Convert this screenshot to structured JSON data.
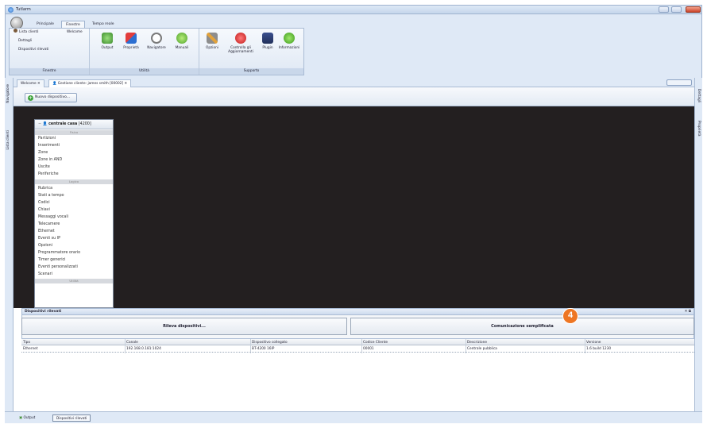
{
  "window": {
    "title": "Tutlarm"
  },
  "ribbon": {
    "tabs": [
      "Principale",
      "Finestre",
      "Tempo reale"
    ],
    "active_tab": "Finestre",
    "finestre_group": {
      "label": "Finestre",
      "items": [
        "Lista clienti",
        "Dettagli",
        "Dispositivi rilevati"
      ],
      "welcome": "Welcome"
    },
    "utilita_group": {
      "label": "Utilità",
      "buttons": [
        "Output",
        "Proprietà",
        "Navigatore",
        "Manuali"
      ]
    },
    "supporto_group": {
      "label": "Supporto",
      "buttons": [
        "Opzioni",
        "Controlla gli Aggiornamenti",
        "Plugin",
        "Informazioni"
      ]
    }
  },
  "side_panels": {
    "left": [
      "Navigatore",
      "Lista clienti"
    ],
    "right": [
      "Dettagli",
      "Proprietà"
    ]
  },
  "doc_tabs": [
    "Welcome",
    "Gestione cliente: james smith [00002]"
  ],
  "toolbar": {
    "new_device_label": "Nuovo dispositivo..."
  },
  "central": {
    "name": "centrale casa",
    "id": "[4200]",
    "sections": [
      "Fisico",
      "Logico",
      "Utilità"
    ],
    "physical_items": [
      "Partizioni",
      "Inserimenti",
      "Zone",
      "Zone in AND",
      "Uscite",
      "Periferiche"
    ],
    "logical_items": [
      "Rubrica",
      "Stati a tempo",
      "Codici",
      "Chiavi",
      "Messaggi vocali",
      "Telecamere",
      "Ethernet",
      "Eventi su IP",
      "Opzioni",
      "Programmatore orario",
      "Timer generici",
      "Eventi personalizzati",
      "Scenari"
    ]
  },
  "bottom_panel": {
    "title": "Dispositivi rilevati",
    "detect_button": "Rileva dispositivi...",
    "simple_comm_button": "Comunicazione semplificata",
    "badge": "4",
    "columns": [
      "Tipo",
      "Canale",
      "Dispositivo collegato",
      "Codice Cliente",
      "Descrizione",
      "Versione"
    ],
    "rows": [
      [
        "Ethernet",
        "192.168.0.181:1024",
        "BT-4200 16IP",
        "00001",
        "Centrale pubblica",
        "1.6 build 1230"
      ]
    ]
  },
  "footer": {
    "tabs": [
      "Output",
      "Dispositivi rilevati"
    ],
    "active_tab": "Dispositivi rilevati"
  },
  "colors": {
    "accent": "#ee7623",
    "canvas": "#231f20",
    "ribbon": "#dfe9f6"
  }
}
